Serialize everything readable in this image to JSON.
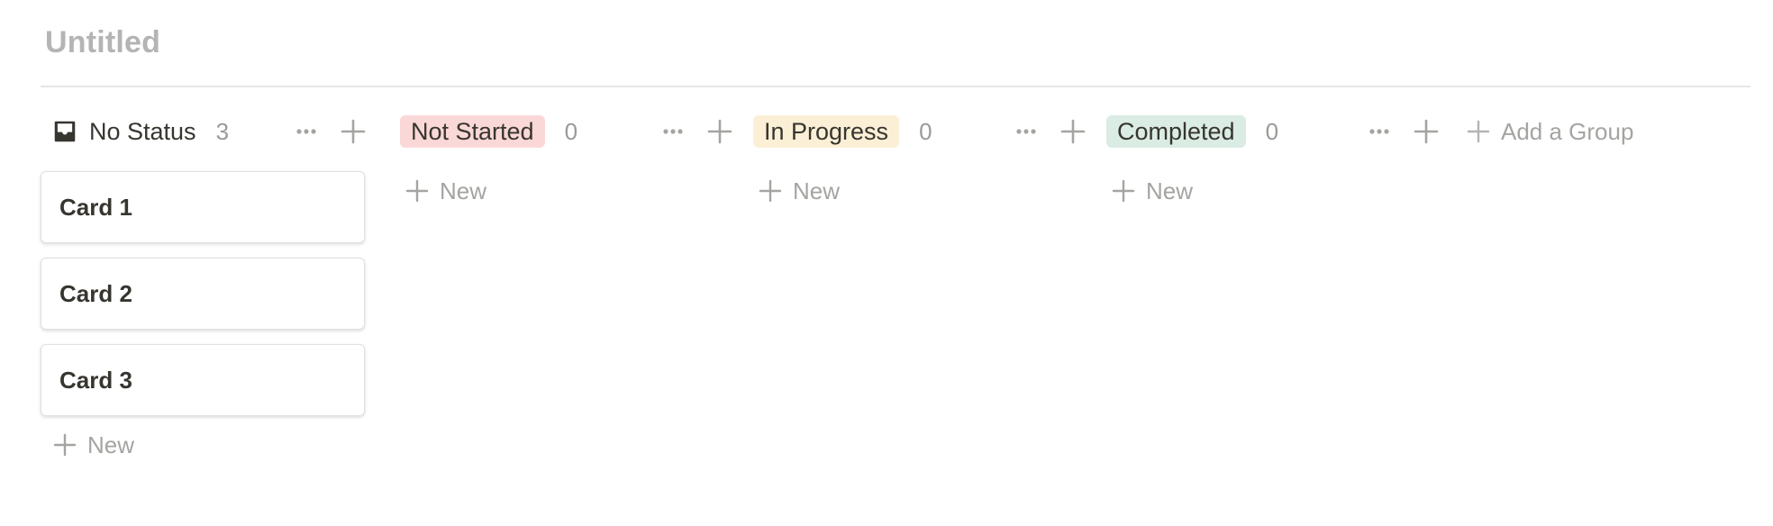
{
  "page": {
    "title": "Untitled"
  },
  "columns": [
    {
      "title": "No Status",
      "count": "3",
      "icon": "inbox-icon",
      "pill_color": "",
      "cards": [
        "Card 1",
        "Card 2",
        "Card 3"
      ],
      "new_label": "New"
    },
    {
      "title": "Not Started",
      "count": "0",
      "pill_color": "#fbd8d8",
      "cards": [],
      "new_label": "New"
    },
    {
      "title": "In Progress",
      "count": "0",
      "pill_color": "#fbefd6",
      "cards": [],
      "new_label": "New"
    },
    {
      "title": "Completed",
      "count": "0",
      "pill_color": "#dbece4",
      "cards": [],
      "new_label": "New"
    }
  ],
  "add_group": {
    "label": "Add a Group"
  },
  "colors": {
    "text": "#37352f",
    "muted": "#9b9a97",
    "title_placeholder": "#b4b4b4"
  }
}
